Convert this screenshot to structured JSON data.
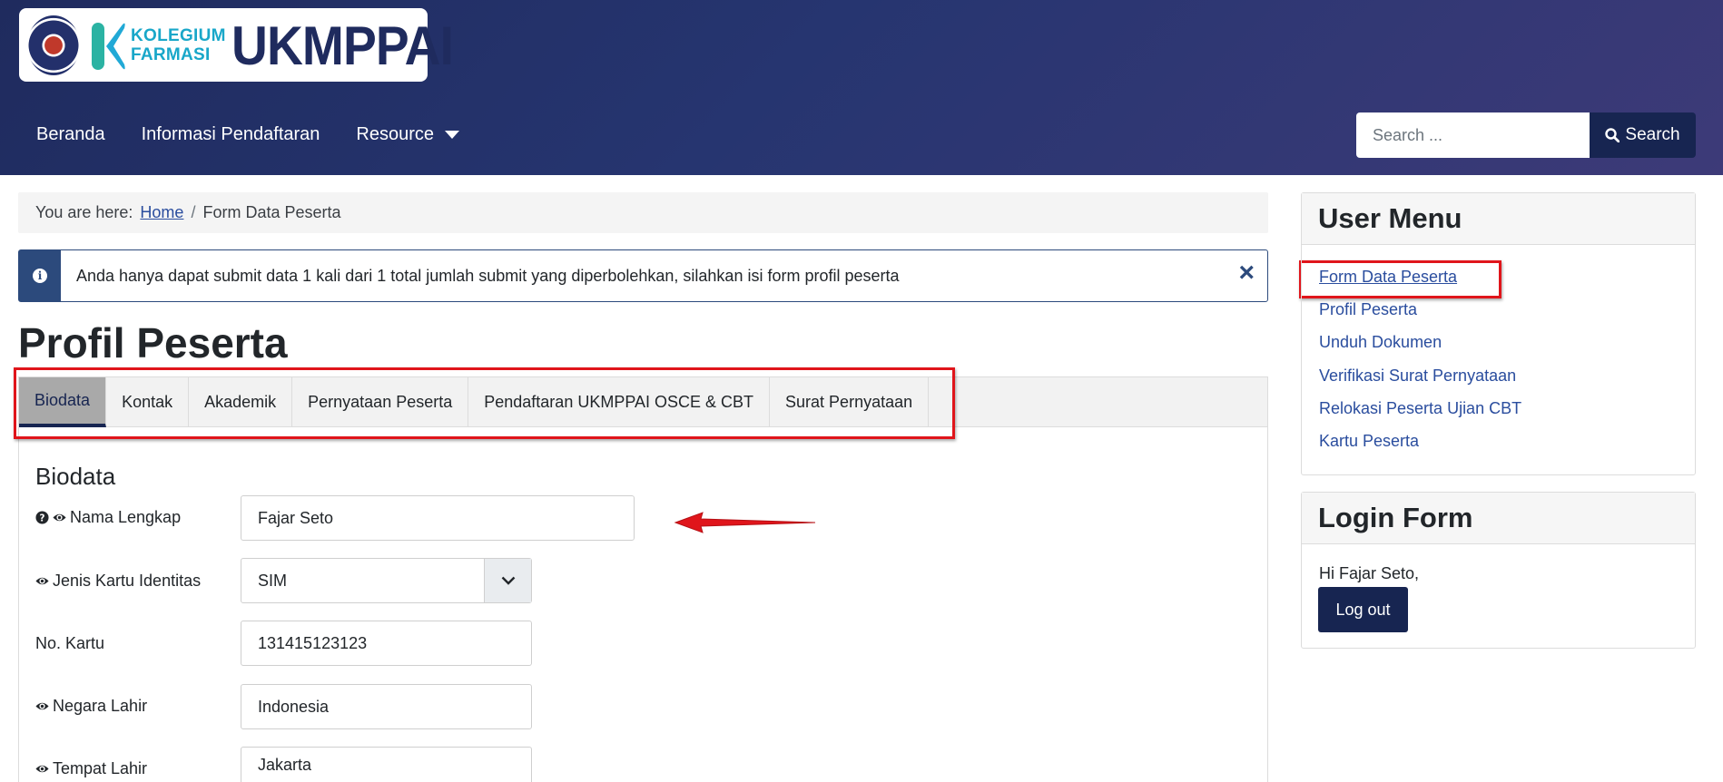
{
  "brand": {
    "kolegium_line1": "KOLEGIUM",
    "kolegium_line2": "FARMASI",
    "title": "UKMPPAI"
  },
  "nav": {
    "items": [
      "Beranda",
      "Informasi Pendaftaran",
      "Resource"
    ]
  },
  "search": {
    "placeholder": "Search ...",
    "button_label": "Search"
  },
  "breadcrumb": {
    "prefix": "You are here:",
    "home": "Home",
    "separator": "/",
    "current": "Form Data Peserta"
  },
  "alert": {
    "text": "Anda hanya dapat submit data 1 kali dari 1 total jumlah submit yang diperbolehkan, silahkan isi form profil peserta",
    "close": "×"
  },
  "page_title": "Profil Peserta",
  "tabs": [
    {
      "label": "Biodata",
      "active": true
    },
    {
      "label": "Kontak",
      "active": false
    },
    {
      "label": "Akademik",
      "active": false
    },
    {
      "label": "Pernyataan Peserta",
      "active": false
    },
    {
      "label": "Pendaftaran UKMPPAI OSCE & CBT",
      "active": false
    },
    {
      "label": "Surat Pernyataan",
      "active": false
    }
  ],
  "form": {
    "section_title": "Biodata",
    "fields": [
      {
        "label": "Nama Lengkap",
        "value": "Fajar Seto",
        "icons": [
          "question-icon",
          "eye-icon"
        ]
      },
      {
        "label": "Jenis Kartu Identitas",
        "value": "SIM",
        "icons": [
          "eye-icon"
        ],
        "type": "select"
      },
      {
        "label": "No. Kartu",
        "value": "131415123123",
        "icons": []
      },
      {
        "label": "Negara Lahir",
        "value": "Indonesia",
        "icons": [
          "eye-icon"
        ]
      },
      {
        "label": "Tempat Lahir",
        "value": "Jakarta",
        "icons": [
          "eye-icon"
        ]
      }
    ]
  },
  "sidebar": {
    "user_menu_title": "User Menu",
    "user_menu_items": [
      "Form Data Peserta",
      "Profil Peserta",
      "Unduh Dokumen",
      "Verifikasi Surat Pernyataan",
      "Relokasi Peserta Ujian CBT",
      "Kartu Peserta"
    ],
    "login_title": "Login Form",
    "greeting": "Hi Fajar Seto,",
    "logout_label": "Log out"
  },
  "colors": {
    "header_navy": "#1f2b5e",
    "button_navy": "#172551",
    "link_blue": "#2a4d9e",
    "annotation_red": "#e0151b"
  }
}
